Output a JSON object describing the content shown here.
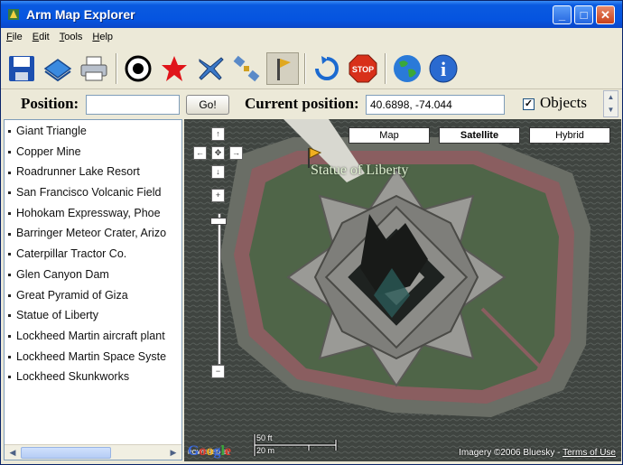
{
  "window": {
    "title": "Arm Map Explorer"
  },
  "window_buttons": {
    "minimize": "_",
    "maximize": "□",
    "close": "✕"
  },
  "menu": [
    "File",
    "Edit",
    "Tools",
    "Help"
  ],
  "toolbar": {
    "buttons": [
      "save-icon",
      "map-layer-icon",
      "print-icon",
      "target-icon",
      "favorite-star-icon",
      "airplane-icon",
      "satellite-icon",
      "flag-icon",
      "refresh-icon",
      "stop-icon",
      "globe-icon",
      "info-icon"
    ],
    "stop_text": "STOP",
    "info_text": "i"
  },
  "position_bar": {
    "position_label": "Position:",
    "position_value": "",
    "go_label": "Go!",
    "current_label": "Current position:",
    "current_value": "40.6898, -74.044",
    "objects_label": "Objects",
    "objects_checked": true,
    "check_mark": "✓"
  },
  "places": [
    "Giant Triangle",
    "Copper Mine",
    "Roadrunner Lake Resort",
    "San Francisco Volcanic Field",
    "Hohokam Expressway, Phoe",
    "Barringer Meteor Crater, Arizo",
    "Caterpillar Tractor Co.",
    "Glen Canyon Dam",
    "Great Pyramid of Giza",
    "Statue of Liberty",
    "Lockheed Martin aircraft plant",
    "Lockheed Martin Space Syste",
    "Lockheed Skunkworks"
  ],
  "map": {
    "types": [
      "Map",
      "Satellite",
      "Hybrid"
    ],
    "active_type": "Satellite",
    "nav": {
      "up": "↑",
      "down": "↓",
      "left": "←",
      "right": "→",
      "center": "✥",
      "zoom_in": "+",
      "zoom_out": "−"
    },
    "zoom_level_fraction": 0.03,
    "poi_label": "Statue of Liberty",
    "scale": {
      "feet": "50 ft",
      "meters": "20 m"
    },
    "powered_by": "POWERED BY",
    "logo_text": "Google",
    "imagery_credit": "Imagery ©2006 Bluesky - ",
    "terms_label": "Terms of Use"
  },
  "colors": {
    "title_bar": "#0554e0",
    "water": "#3a3f3c",
    "lawn": "#4f6548",
    "walkway": "#8a5e60",
    "pedestal": "#8a8a86"
  }
}
